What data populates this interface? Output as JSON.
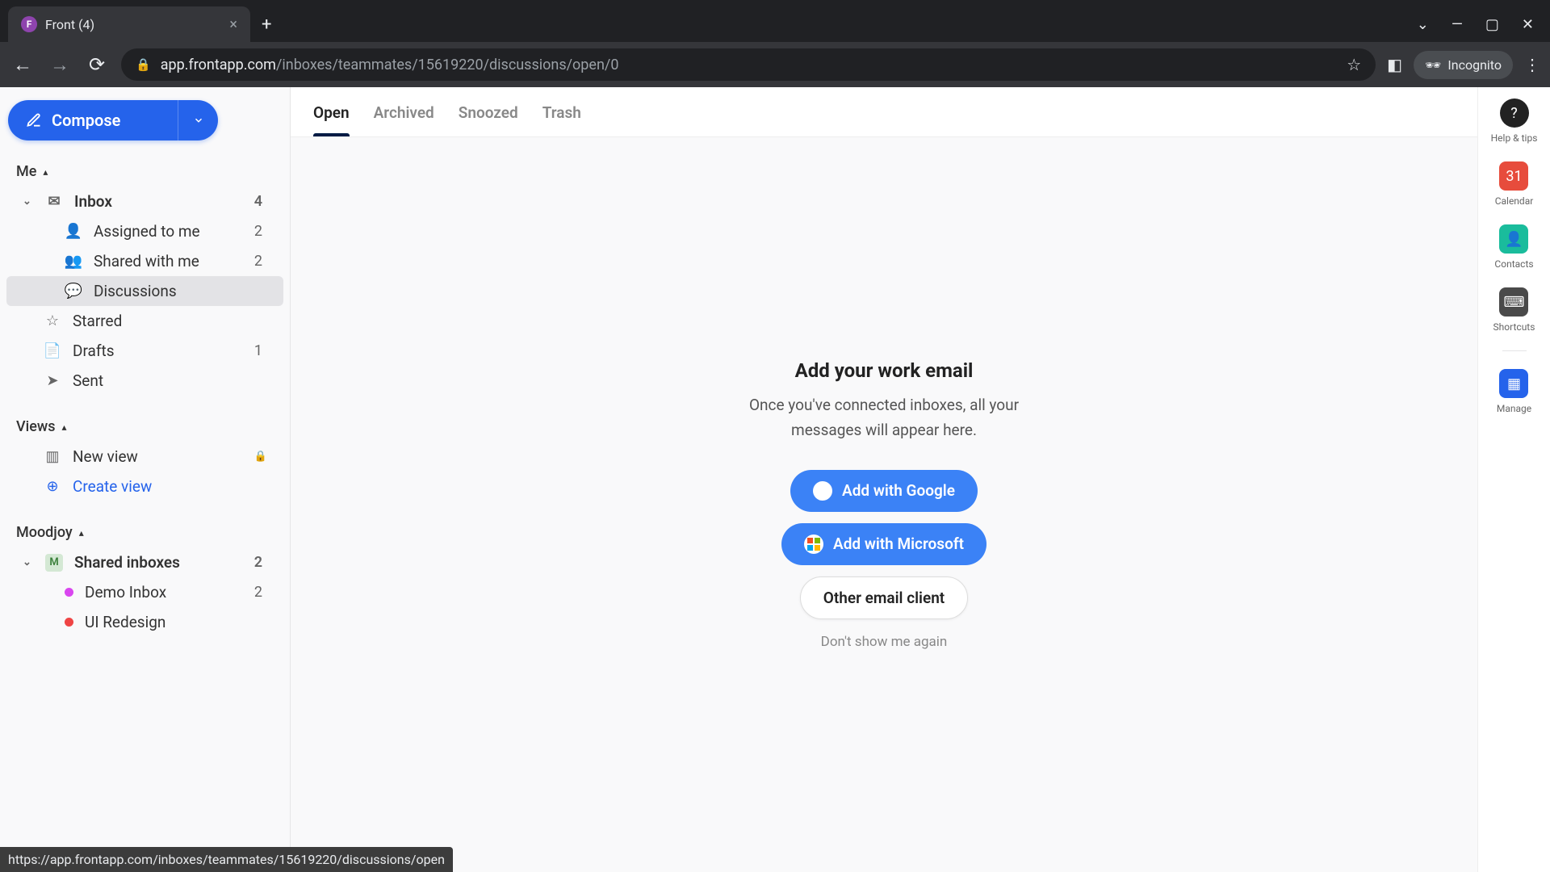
{
  "browser": {
    "tab_title": "Front (4)",
    "url_display_host": "app.frontapp.com",
    "url_display_path": "/inboxes/teammates/15619220/discussions/open/0",
    "incognito_label": "Incognito",
    "status_url": "https://app.frontapp.com/inboxes/teammates/15619220/discussions/open"
  },
  "compose": {
    "label": "Compose"
  },
  "sidebar": {
    "me_label": "Me",
    "inbox": {
      "label": "Inbox",
      "count": "4"
    },
    "assigned": {
      "label": "Assigned to me",
      "count": "2"
    },
    "shared_with_me": {
      "label": "Shared with me",
      "count": "2"
    },
    "discussions": {
      "label": "Discussions"
    },
    "starred": {
      "label": "Starred"
    },
    "drafts": {
      "label": "Drafts",
      "count": "1"
    },
    "sent": {
      "label": "Sent"
    },
    "views_label": "Views",
    "new_view": {
      "label": "New view"
    },
    "create_view": {
      "label": "Create view"
    },
    "workspace_label": "Moodjoy",
    "shared_inboxes": {
      "label": "Shared inboxes",
      "count": "2",
      "badge": "M"
    },
    "demo_inbox": {
      "label": "Demo Inbox",
      "count": "2",
      "color": "#d946ef"
    },
    "ui_redesign": {
      "label": "UI Redesign",
      "color": "#ef4444"
    }
  },
  "main_tabs": {
    "open": "Open",
    "archived": "Archived",
    "snoozed": "Snoozed",
    "trash": "Trash"
  },
  "empty": {
    "title": "Add your work email",
    "subtitle": "Once you've connected inboxes, all your messages will appear here.",
    "google": "Add with Google",
    "microsoft": "Add with Microsoft",
    "other": "Other email client",
    "dismiss": "Don't show me again"
  },
  "rail": {
    "help": "Help & tips",
    "calendar": "Calendar",
    "contacts": "Contacts",
    "shortcuts": "Shortcuts",
    "manage": "Manage"
  }
}
